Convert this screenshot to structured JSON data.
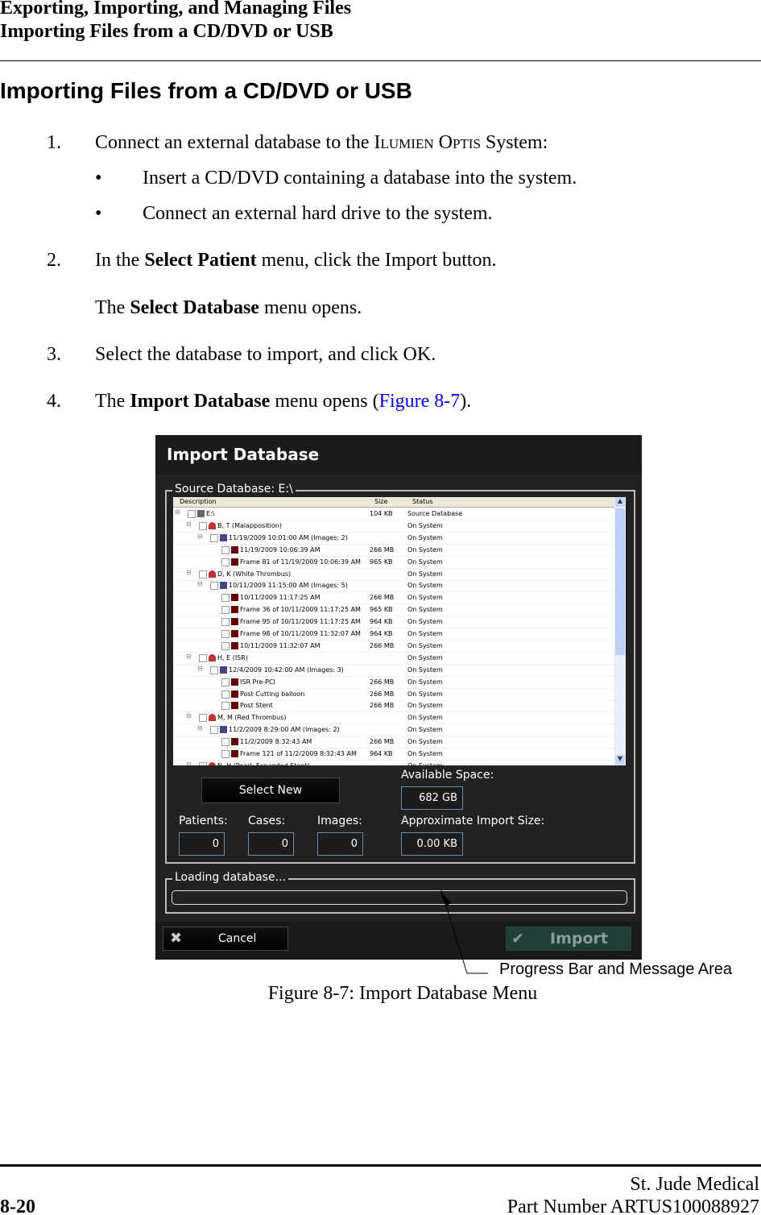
{
  "header": {
    "line1": "Exporting, Importing, and Managing Files",
    "line2": "Importing Files from a CD/DVD or USB"
  },
  "heading": "Importing Files from a CD/DVD or USB",
  "steps": [
    {
      "num": "1.",
      "pre": "Connect an external database to the ",
      "sc": "Ilumien Optis",
      "post": " System:"
    },
    {
      "bullet": "•",
      "text": "Insert a CD/DVD containing a database into the system."
    },
    {
      "bullet": "•",
      "text": "Connect an external hard drive to the system."
    },
    {
      "num": "2.",
      "pre": "In the ",
      "bold": "Select Patient",
      "post": " menu, click the Import button."
    },
    {
      "pre": "The ",
      "bold": "Select Database",
      "post": " menu opens."
    },
    {
      "num": "3.",
      "text": "Select the database to import, and click OK."
    },
    {
      "num": "4.",
      "pre": "The ",
      "bold": "Import Database",
      "mid": " menu opens (",
      "link": "Figure 8-7",
      "post": ")."
    }
  ],
  "dialog": {
    "title": "Import Database",
    "source_label": "Source Database: E:\\",
    "columns": [
      "Description",
      "Size",
      "Status"
    ],
    "rows": [
      {
        "level": 0,
        "icon": "database-icon",
        "text": "E:\\",
        "size": "104 KB",
        "status": "Source Database"
      },
      {
        "level": 1,
        "icon": "patient-icon",
        "text": "B, T (Malapposition)",
        "size": "",
        "status": "On System"
      },
      {
        "level": 2,
        "icon": "case-icon",
        "text": "11/19/2009 10:01:00 AM (Images: 2)",
        "size": "",
        "status": "On System"
      },
      {
        "level": 3,
        "icon": "image-icon",
        "text": "11/19/2009 10:06:39 AM",
        "size": "266 MB",
        "status": "On System"
      },
      {
        "level": 3,
        "icon": "image-icon",
        "text": "Frame 81 of 11/19/2009 10:06:39 AM",
        "size": "965 KB",
        "status": "On System"
      },
      {
        "level": 1,
        "icon": "patient-icon",
        "text": "D, K (White Thrombus)",
        "size": "",
        "status": "On System"
      },
      {
        "level": 2,
        "icon": "case-icon",
        "text": "10/11/2009 11:15:00 AM (Images: 5)",
        "size": "",
        "status": "On System"
      },
      {
        "level": 3,
        "icon": "image-icon",
        "text": "10/11/2009 11:17:25 AM",
        "size": "266 MB",
        "status": "On System"
      },
      {
        "level": 3,
        "icon": "image-icon",
        "text": "Frame 36 of 10/11/2009 11:17:25 AM",
        "size": "965 KB",
        "status": "On System"
      },
      {
        "level": 3,
        "icon": "image-icon",
        "text": "Frame 95 of 10/11/2009 11:17:25 AM",
        "size": "964 KB",
        "status": "On System"
      },
      {
        "level": 3,
        "icon": "image-icon",
        "text": "Frame 98 of 10/11/2009 11:32:07 AM",
        "size": "964 KB",
        "status": "On System"
      },
      {
        "level": 3,
        "icon": "image-icon",
        "text": "10/11/2009 11:32:07 AM",
        "size": "266 MB",
        "status": "On System"
      },
      {
        "level": 1,
        "icon": "patient-icon",
        "text": "H, E (ISR)",
        "size": "",
        "status": "On System"
      },
      {
        "level": 2,
        "icon": "case-icon",
        "text": "12/4/2009 10:42:00 AM (Images: 3)",
        "size": "",
        "status": "On System"
      },
      {
        "level": 3,
        "icon": "image-icon",
        "text": "ISR Pre-PCI",
        "size": "266 MB",
        "status": "On System"
      },
      {
        "level": 3,
        "icon": "image-icon",
        "text": "Post Cutting balloon",
        "size": "266 MB",
        "status": "On System"
      },
      {
        "level": 3,
        "icon": "image-icon",
        "text": "Post Stent",
        "size": "266 MB",
        "status": "On System"
      },
      {
        "level": 1,
        "icon": "patient-icon",
        "text": "M, M (Red Thrombus)",
        "size": "",
        "status": "On System"
      },
      {
        "level": 2,
        "icon": "case-icon",
        "text": "11/2/2009 8:29:00 AM (Images: 2)",
        "size": "",
        "status": "On System"
      },
      {
        "level": 3,
        "icon": "image-icon",
        "text": "11/2/2009 8:32:43 AM",
        "size": "266 MB",
        "status": "On System"
      },
      {
        "level": 3,
        "icon": "image-icon",
        "text": "Frame 121 of 11/2/2009 8:32:43 AM",
        "size": "964 KB",
        "status": "On System"
      },
      {
        "level": 1,
        "icon": "patient-icon",
        "text": "N, H (Pearl: Expanded Stent)",
        "size": "",
        "status": "On System"
      }
    ],
    "select_new": "Select New",
    "available_space_label": "Available Space:",
    "available_space": "682 GB",
    "patients_label": "Patients:",
    "patients": "0",
    "cases_label": "Cases:",
    "cases": "0",
    "images_label": "Images:",
    "images": "0",
    "import_size_label": "Approximate Import Size:",
    "import_size": "0.00 KB",
    "loading_label": "Loading database...",
    "progress": 0,
    "cancel": "Cancel",
    "import": "Import"
  },
  "callout": "Progress Bar and Message Area",
  "caption": "Figure 8-7:  Import Database Menu",
  "footer": {
    "company": "St. Jude Medical",
    "page": "8-20",
    "part": "Part Number ARTUS100088927"
  }
}
